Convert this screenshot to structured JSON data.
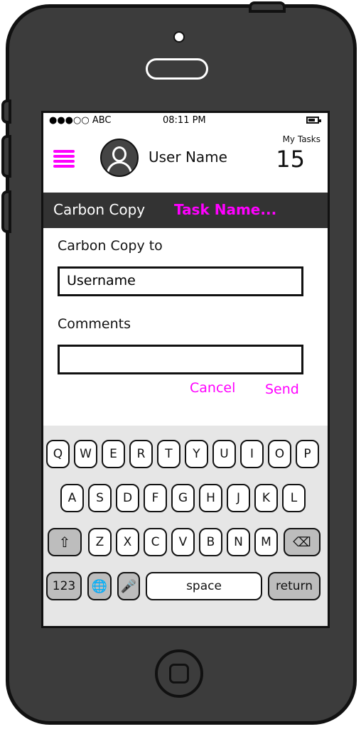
{
  "status_bar": {
    "carrier": "●●●○○ ABC",
    "time": "08:11 PM"
  },
  "header": {
    "menu_icon": "hamburger-icon",
    "avatar_icon": "user-avatar-icon",
    "user_name": "User Name",
    "my_tasks_label": "My Tasks",
    "my_tasks_count": "15"
  },
  "title_bar": {
    "title": "Carbon Copy",
    "task_name": "Task Name..."
  },
  "form": {
    "cc_label": "Carbon Copy to",
    "cc_value": "Username",
    "comments_label": "Comments",
    "comments_value": "",
    "cancel_label": "Cancel",
    "send_label": "Send"
  },
  "keyboard": {
    "row1": [
      "Q",
      "W",
      "E",
      "R",
      "T",
      "Y",
      "U",
      "I",
      "O",
      "P"
    ],
    "row2": [
      "A",
      "S",
      "D",
      "F",
      "G",
      "H",
      "J",
      "K",
      "L"
    ],
    "row3": [
      "Z",
      "X",
      "C",
      "V",
      "B",
      "N",
      "M"
    ],
    "shift_icon": "shift-icon",
    "backspace_icon": "backspace-icon",
    "numbers_label": "123",
    "globe_icon": "globe-icon",
    "mic_icon": "microphone-icon",
    "space_label": "space",
    "return_label": "return"
  },
  "colors": {
    "accent": "#ff00ff",
    "title_bar": "#333333",
    "phone_body": "#3c3c3c"
  }
}
